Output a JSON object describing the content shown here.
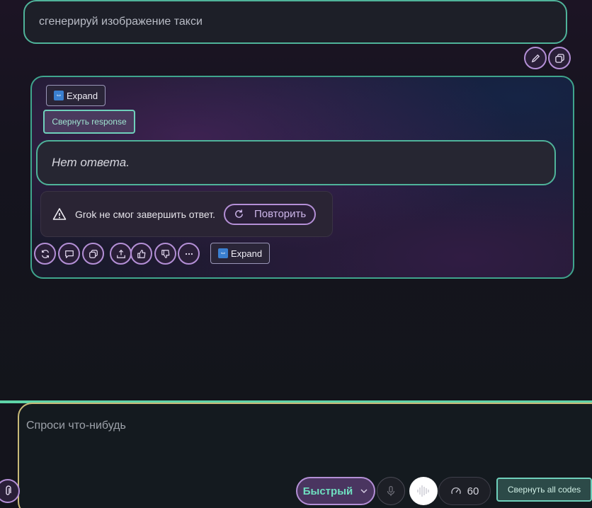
{
  "user_message": {
    "text": "сгенерируй изображение такси"
  },
  "user_message_actions": [
    {
      "name": "edit-button",
      "icon": "pencil-icon"
    },
    {
      "name": "copy-button",
      "icon": "copy-icon"
    }
  ],
  "response": {
    "expand_label": "Expand",
    "collapse_label": "Свернуть response",
    "no_answer_text": "Нет ответа.",
    "error_text": "Grok не смог завершить ответ.",
    "retry_label": "Повторить",
    "actions": [
      {
        "name": "regenerate-button",
        "icon": "refresh-icon"
      },
      {
        "name": "comment-button",
        "icon": "speech-bubble-icon"
      },
      {
        "name": "copy-response-button",
        "icon": "copy-icon"
      },
      {
        "name": "share-button",
        "icon": "share-icon"
      },
      {
        "name": "like-button",
        "icon": "thumbs-up-icon"
      },
      {
        "name": "dislike-button",
        "icon": "thumbs-down-icon"
      },
      {
        "name": "more-button",
        "icon": "ellipsis-icon"
      }
    ],
    "footer_expand_label": "Expand"
  },
  "composer": {
    "placeholder": "Спроси что-нибудь",
    "mode_label": "Быстрый",
    "speed_value": "60",
    "collapse_codes_label": "Свернуть all codes"
  },
  "colors": {
    "accent_green": "#4fb39a",
    "accent_purple": "#b48fd6",
    "composer_border": "#c8b978"
  }
}
